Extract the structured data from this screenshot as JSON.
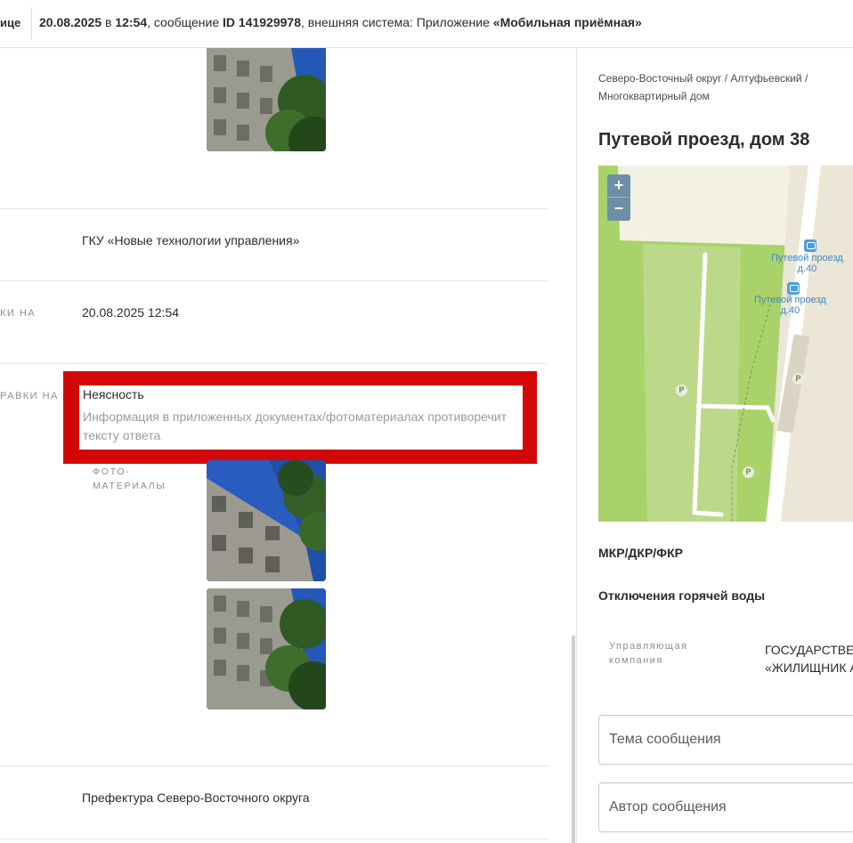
{
  "header": {
    "cut_label": "ице",
    "date": "20.08.2025",
    "in_word": "в",
    "time": "12:54",
    "message_word": ", сообщение",
    "id_label": "ID 141929978",
    "external_text": ", внешняя система: Приложение",
    "app_name": "«Мобильная приёмная»"
  },
  "rows": {
    "organization_value": "ГКУ «Новые технологии управления»",
    "date_label_cut": "ки на",
    "date_value": "20.08.2025 12:54",
    "reason_label_cut": "равки на",
    "prefecture_value": "Префектура Северо-Восточного округа"
  },
  "highlight": {
    "title": "Неясность",
    "description": "Информация в приложенных документах/фотоматериалах противоречит тексту ответа"
  },
  "photos_label": "Фото-\nматериалы",
  "sidebar": {
    "breadcrumb": "Северо-Восточный округ / Алтуфьевский / Многоквартирный дом",
    "address": "Путевой проезд, дом 38",
    "map": {
      "zoom_in": "+",
      "zoom_out": "−",
      "stop1": "Путевой проезд\nд.40",
      "stop2": "Путевой проезд\nд.40",
      "parking": "P"
    },
    "section_mkr": "МКР/ДКР/ФКР",
    "section_hot_water": "Отключения горячей воды",
    "management_label": "Управляющая\nкомпания",
    "management_value": "ГОСУДАРСТВЕН\n«ЖИЛИЩНИК А"
  },
  "form": {
    "subject_placeholder": "Тема сообщения",
    "author_placeholder": "Автор сообщения"
  },
  "colors": {
    "highlight_red": "#d20808",
    "map_green": "#a9d26a",
    "transit_blue": "#4a9ee0"
  }
}
